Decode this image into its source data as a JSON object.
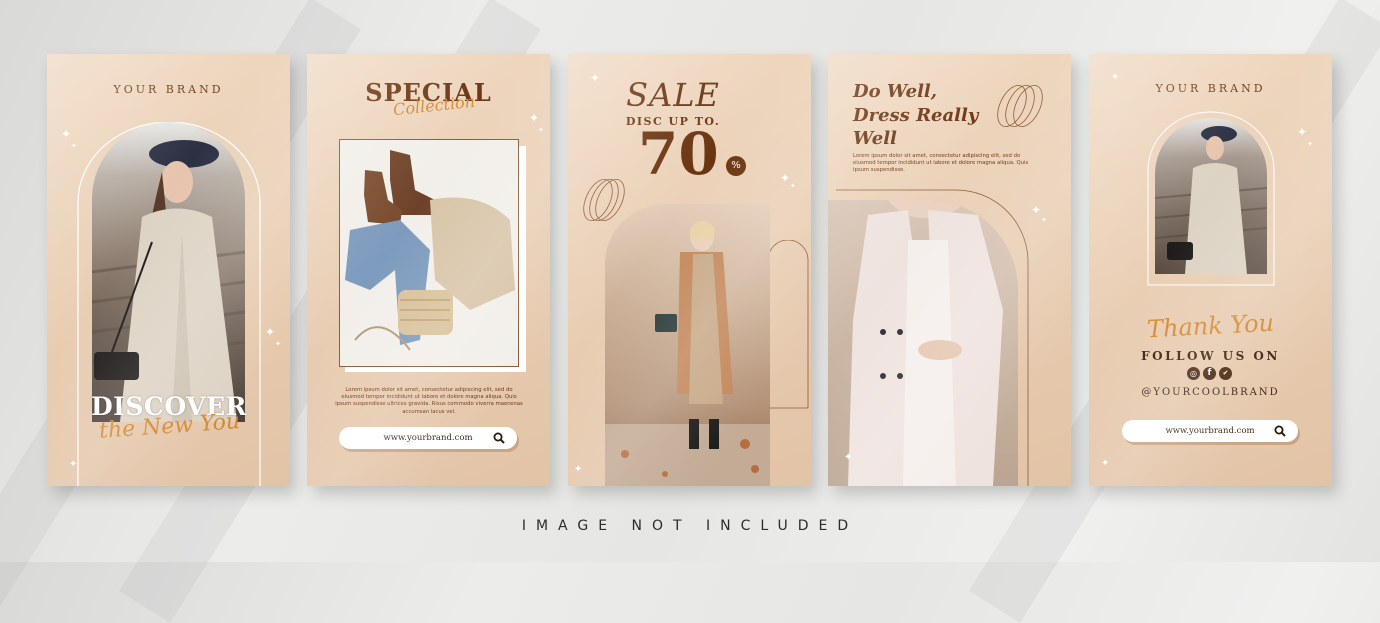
{
  "card1": {
    "brand": "YOUR BRAND",
    "headline": "DISCOVER",
    "script": "the New You"
  },
  "card2": {
    "title": "SPECIAL",
    "script": "Collection",
    "body": "Lorem ipsum dolor sit amet, consectetur adipiscing elit, sed do eiusmod tempor incididunt ut labore et dolore magna aliqua. Quis ipsum suspendisse ultrices gravida. Risus commodo viverra maecenas accumsan lacus vel.",
    "url": "www.yourbrand.com"
  },
  "card3": {
    "title": "SALE",
    "subtitle": "DISC UP TO.",
    "number": "70",
    "percent": "%"
  },
  "card4": {
    "line1": "Do Well,",
    "line2": "Dress Really",
    "line3": "Well",
    "body": "Lorem ipsum dolor sit amet, consectetur adipiscing elit, sed do eiusmod tempor incididunt ut labore et dolore magna aliqua. Quis ipsum suspendisse."
  },
  "card5": {
    "brand": "YOUR BRAND",
    "script": "Thank You",
    "follow": "FOLLOW US ON",
    "handle": "@YOURCOOLBRAND",
    "url": "www.yourbrand.com",
    "social_icons": [
      "instagram-icon",
      "facebook-icon",
      "twitter-icon"
    ]
  },
  "caption": "IMAGE NOT INCLUDED",
  "colors": {
    "accent_brown": "#6b3410",
    "script_gold": "#d48a32",
    "card_bg": "#ecd2b9"
  }
}
